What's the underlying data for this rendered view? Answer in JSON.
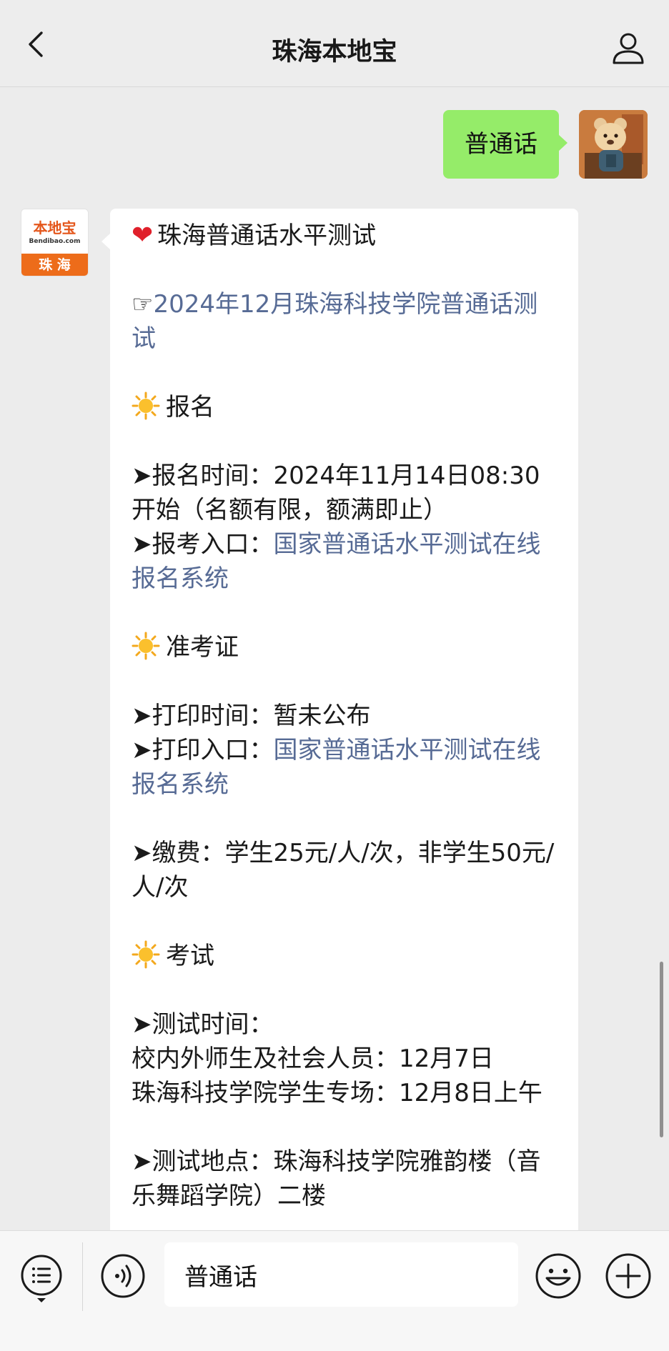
{
  "header": {
    "title": "珠海本地宝"
  },
  "user_message": {
    "text": "普通话"
  },
  "bot": {
    "avatar": {
      "logo_main": "本地宝",
      "logo_sub": "Bendibao.com",
      "city": "珠 海"
    },
    "title": "珠海普通话水平测试",
    "lines": [
      {
        "prefix": "☞",
        "link": "2024年12月珠海科技学院普通话测试"
      },
      {
        "sun": true,
        "text": "报名"
      },
      {
        "text": "➤报名时间：2024年11月14日08:30开始（名额有限，额满即止）"
      },
      {
        "text": "➤报考入口：",
        "link": "国家普通话水平测试在线报名系统"
      },
      {
        "sun": true,
        "text": "准考证"
      },
      {
        "text": "➤打印时间：暂未公布"
      },
      {
        "text": "➤打印入口：",
        "link": "国家普通话水平测试在线报名系统"
      },
      {
        "text": "➤缴费：学生25元/人/次，非学生50元/人/次"
      },
      {
        "sun": true,
        "text": "考试"
      },
      {
        "text": "➤测试时间："
      },
      {
        "text": "校内外师生及社会人员：12月7日"
      },
      {
        "text": "珠海科技学院学生专场：12月8日上午"
      },
      {
        "text": "➤测试地点：珠海科技学院雅韵楼（音乐舞蹈学院）二楼"
      }
    ]
  },
  "input": {
    "value": "普通话"
  },
  "colors": {
    "user_bubble": "#95ec69",
    "link": "#576b95",
    "brand_orange": "#ed6c1a"
  },
  "icons": {
    "back": "chevron-left-icon",
    "profile": "user-icon",
    "menu": "list-menu-icon",
    "voice": "voice-icon",
    "emoji": "smiley-icon",
    "plus": "plus-icon"
  }
}
